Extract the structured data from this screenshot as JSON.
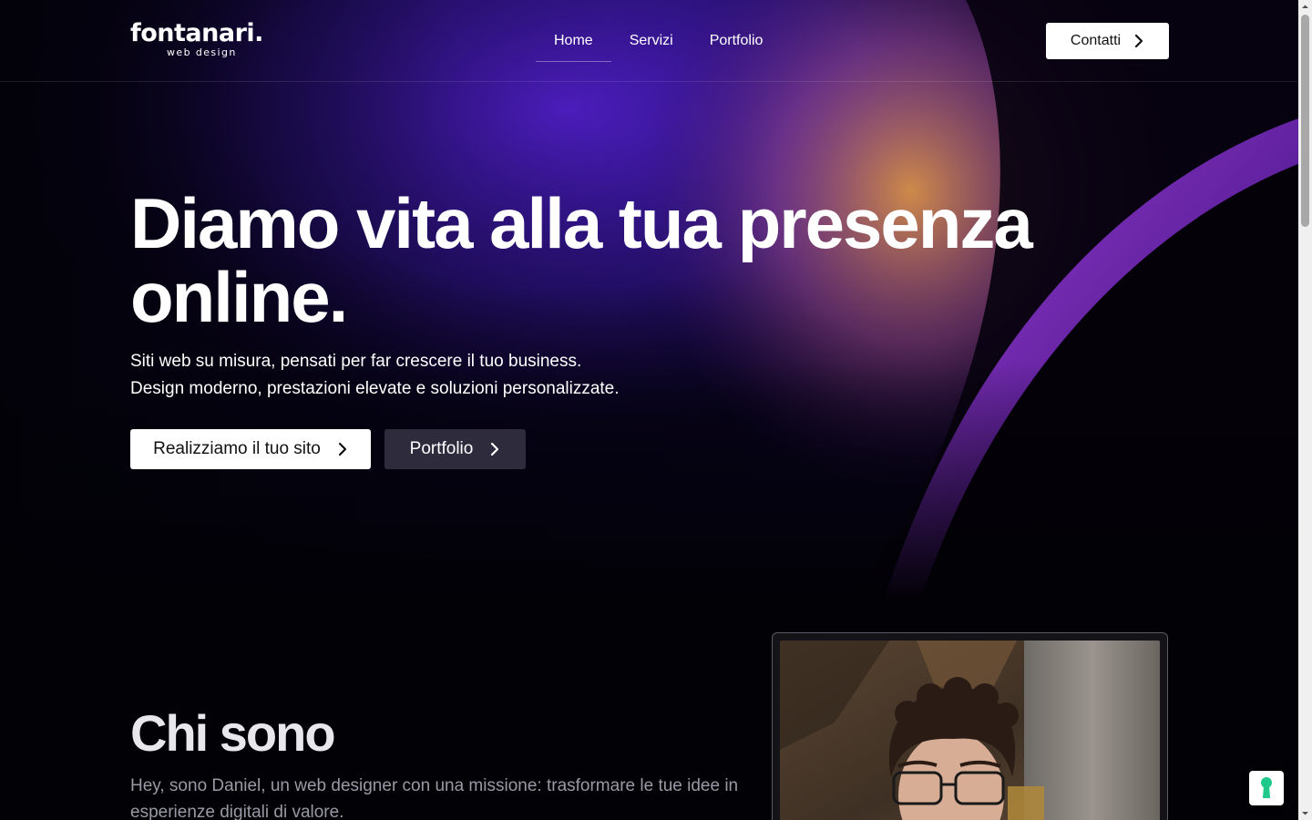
{
  "brand": {
    "name": "fontanari.",
    "tagline": "web design"
  },
  "nav": {
    "items": [
      {
        "label": "Home",
        "active": true
      },
      {
        "label": "Servizi",
        "active": false
      },
      {
        "label": "Portfolio",
        "active": false
      }
    ],
    "cta_label": "Contatti"
  },
  "hero": {
    "title": "Diamo vita alla tua presenza online.",
    "subtitle_lines": [
      "Siti web su misura, pensati per far crescere il tuo business.",
      "Design moderno, prestazioni elevate e soluzioni personalizzate."
    ],
    "primary_button": "Realizziamo il tuo sito",
    "secondary_button": "Portfolio"
  },
  "about": {
    "title": "Chi sono",
    "text": "Hey, sono Daniel, un web designer con una missione: trasformare le tue idee in esperienze digitali di valore."
  },
  "icons": {
    "button_arrow": "chevron-right-icon",
    "widget": "keyhole-icon"
  },
  "colors": {
    "background": "#020106",
    "accent_purple": "#4a1fc9",
    "accent_orange": "#c8874a",
    "widget_icon": "#1fc98a"
  }
}
